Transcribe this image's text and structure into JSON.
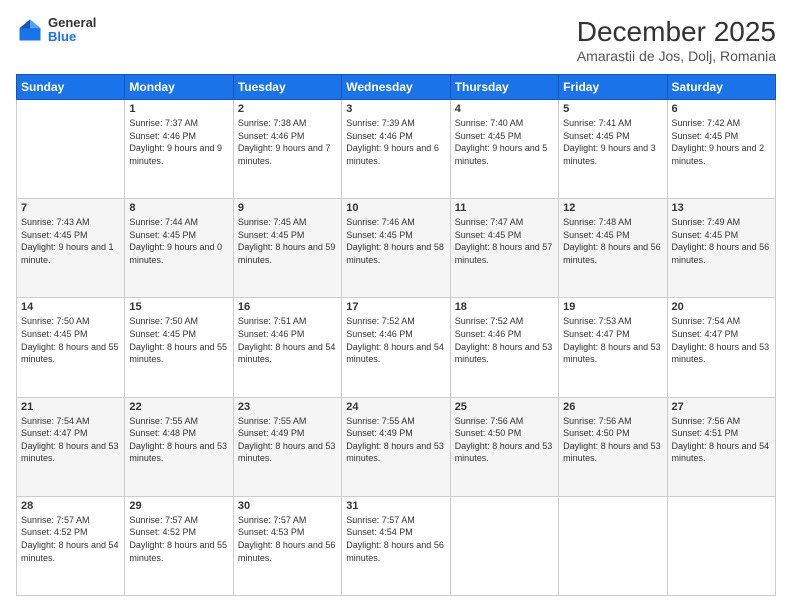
{
  "header": {
    "logo": {
      "line1": "General",
      "line2": "Blue"
    },
    "title": "December 2025",
    "subtitle": "Amarastii de Jos, Dolj, Romania"
  },
  "weekdays": [
    "Sunday",
    "Monday",
    "Tuesday",
    "Wednesday",
    "Thursday",
    "Friday",
    "Saturday"
  ],
  "weeks": [
    [
      {
        "day": "",
        "sunrise": "",
        "sunset": "",
        "daylight": ""
      },
      {
        "day": "1",
        "sunrise": "Sunrise: 7:37 AM",
        "sunset": "Sunset: 4:46 PM",
        "daylight": "Daylight: 9 hours and 9 minutes."
      },
      {
        "day": "2",
        "sunrise": "Sunrise: 7:38 AM",
        "sunset": "Sunset: 4:46 PM",
        "daylight": "Daylight: 9 hours and 7 minutes."
      },
      {
        "day": "3",
        "sunrise": "Sunrise: 7:39 AM",
        "sunset": "Sunset: 4:46 PM",
        "daylight": "Daylight: 9 hours and 6 minutes."
      },
      {
        "day": "4",
        "sunrise": "Sunrise: 7:40 AM",
        "sunset": "Sunset: 4:45 PM",
        "daylight": "Daylight: 9 hours and 5 minutes."
      },
      {
        "day": "5",
        "sunrise": "Sunrise: 7:41 AM",
        "sunset": "Sunset: 4:45 PM",
        "daylight": "Daylight: 9 hours and 3 minutes."
      },
      {
        "day": "6",
        "sunrise": "Sunrise: 7:42 AM",
        "sunset": "Sunset: 4:45 PM",
        "daylight": "Daylight: 9 hours and 2 minutes."
      }
    ],
    [
      {
        "day": "7",
        "sunrise": "Sunrise: 7:43 AM",
        "sunset": "Sunset: 4:45 PM",
        "daylight": "Daylight: 9 hours and 1 minute."
      },
      {
        "day": "8",
        "sunrise": "Sunrise: 7:44 AM",
        "sunset": "Sunset: 4:45 PM",
        "daylight": "Daylight: 9 hours and 0 minutes."
      },
      {
        "day": "9",
        "sunrise": "Sunrise: 7:45 AM",
        "sunset": "Sunset: 4:45 PM",
        "daylight": "Daylight: 8 hours and 59 minutes."
      },
      {
        "day": "10",
        "sunrise": "Sunrise: 7:46 AM",
        "sunset": "Sunset: 4:45 PM",
        "daylight": "Daylight: 8 hours and 58 minutes."
      },
      {
        "day": "11",
        "sunrise": "Sunrise: 7:47 AM",
        "sunset": "Sunset: 4:45 PM",
        "daylight": "Daylight: 8 hours and 57 minutes."
      },
      {
        "day": "12",
        "sunrise": "Sunrise: 7:48 AM",
        "sunset": "Sunset: 4:45 PM",
        "daylight": "Daylight: 8 hours and 56 minutes."
      },
      {
        "day": "13",
        "sunrise": "Sunrise: 7:49 AM",
        "sunset": "Sunset: 4:45 PM",
        "daylight": "Daylight: 8 hours and 56 minutes."
      }
    ],
    [
      {
        "day": "14",
        "sunrise": "Sunrise: 7:50 AM",
        "sunset": "Sunset: 4:45 PM",
        "daylight": "Daylight: 8 hours and 55 minutes."
      },
      {
        "day": "15",
        "sunrise": "Sunrise: 7:50 AM",
        "sunset": "Sunset: 4:45 PM",
        "daylight": "Daylight: 8 hours and 55 minutes."
      },
      {
        "day": "16",
        "sunrise": "Sunrise: 7:51 AM",
        "sunset": "Sunset: 4:46 PM",
        "daylight": "Daylight: 8 hours and 54 minutes."
      },
      {
        "day": "17",
        "sunrise": "Sunrise: 7:52 AM",
        "sunset": "Sunset: 4:46 PM",
        "daylight": "Daylight: 8 hours and 54 minutes."
      },
      {
        "day": "18",
        "sunrise": "Sunrise: 7:52 AM",
        "sunset": "Sunset: 4:46 PM",
        "daylight": "Daylight: 8 hours and 53 minutes."
      },
      {
        "day": "19",
        "sunrise": "Sunrise: 7:53 AM",
        "sunset": "Sunset: 4:47 PM",
        "daylight": "Daylight: 8 hours and 53 minutes."
      },
      {
        "day": "20",
        "sunrise": "Sunrise: 7:54 AM",
        "sunset": "Sunset: 4:47 PM",
        "daylight": "Daylight: 8 hours and 53 minutes."
      }
    ],
    [
      {
        "day": "21",
        "sunrise": "Sunrise: 7:54 AM",
        "sunset": "Sunset: 4:47 PM",
        "daylight": "Daylight: 8 hours and 53 minutes."
      },
      {
        "day": "22",
        "sunrise": "Sunrise: 7:55 AM",
        "sunset": "Sunset: 4:48 PM",
        "daylight": "Daylight: 8 hours and 53 minutes."
      },
      {
        "day": "23",
        "sunrise": "Sunrise: 7:55 AM",
        "sunset": "Sunset: 4:49 PM",
        "daylight": "Daylight: 8 hours and 53 minutes."
      },
      {
        "day": "24",
        "sunrise": "Sunrise: 7:55 AM",
        "sunset": "Sunset: 4:49 PM",
        "daylight": "Daylight: 8 hours and 53 minutes."
      },
      {
        "day": "25",
        "sunrise": "Sunrise: 7:56 AM",
        "sunset": "Sunset: 4:50 PM",
        "daylight": "Daylight: 8 hours and 53 minutes."
      },
      {
        "day": "26",
        "sunrise": "Sunrise: 7:56 AM",
        "sunset": "Sunset: 4:50 PM",
        "daylight": "Daylight: 8 hours and 53 minutes."
      },
      {
        "day": "27",
        "sunrise": "Sunrise: 7:56 AM",
        "sunset": "Sunset: 4:51 PM",
        "daylight": "Daylight: 8 hours and 54 minutes."
      }
    ],
    [
      {
        "day": "28",
        "sunrise": "Sunrise: 7:57 AM",
        "sunset": "Sunset: 4:52 PM",
        "daylight": "Daylight: 8 hours and 54 minutes."
      },
      {
        "day": "29",
        "sunrise": "Sunrise: 7:57 AM",
        "sunset": "Sunset: 4:52 PM",
        "daylight": "Daylight: 8 hours and 55 minutes."
      },
      {
        "day": "30",
        "sunrise": "Sunrise: 7:57 AM",
        "sunset": "Sunset: 4:53 PM",
        "daylight": "Daylight: 8 hours and 56 minutes."
      },
      {
        "day": "31",
        "sunrise": "Sunrise: 7:57 AM",
        "sunset": "Sunset: 4:54 PM",
        "daylight": "Daylight: 8 hours and 56 minutes."
      },
      {
        "day": "",
        "sunrise": "",
        "sunset": "",
        "daylight": ""
      },
      {
        "day": "",
        "sunrise": "",
        "sunset": "",
        "daylight": ""
      },
      {
        "day": "",
        "sunrise": "",
        "sunset": "",
        "daylight": ""
      }
    ]
  ]
}
